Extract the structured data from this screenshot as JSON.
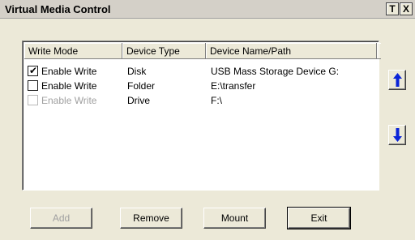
{
  "window": {
    "title": "Virtual Media Control",
    "titlebar_buttons": [
      "T",
      "X"
    ]
  },
  "list": {
    "columns": [
      "Write Mode",
      "Device Type",
      "Device Name/Path"
    ],
    "rows": [
      {
        "checked": true,
        "enabled": true,
        "mode": "Enable Write",
        "type": "Disk",
        "path": "USB Mass Storage Device G:"
      },
      {
        "checked": false,
        "enabled": true,
        "mode": "Enable Write",
        "type": "Folder",
        "path": "E:\\transfer"
      },
      {
        "checked": false,
        "enabled": false,
        "mode": "Enable Write",
        "type": "Drive",
        "path": "F:\\"
      }
    ]
  },
  "side": {
    "up_icon": "arrow-up-icon",
    "down_icon": "arrow-down-icon",
    "arrow_color": "#0a24d8"
  },
  "buttons": {
    "add": "Add",
    "remove": "Remove",
    "mount": "Mount",
    "exit": "Exit"
  }
}
